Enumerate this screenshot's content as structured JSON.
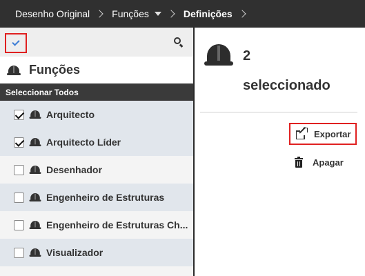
{
  "breadcrumb": {
    "items": [
      "Desenho Original",
      "Funções",
      "Definições"
    ]
  },
  "toolbar": {
    "select_toggle_icon": "checkmark-icon",
    "search_icon": "search-icon"
  },
  "panel": {
    "title": "Funções",
    "select_all_label": "Seleccionar Todos",
    "items": [
      {
        "label": "Arquitecto",
        "checked": true
      },
      {
        "label": "Arquitecto Líder",
        "checked": true
      },
      {
        "label": "Desenhador",
        "checked": false
      },
      {
        "label": "Engenheiro de Estruturas",
        "checked": false
      },
      {
        "label": "Engenheiro de Estruturas Ch...",
        "checked": false
      },
      {
        "label": "Visualizador",
        "checked": false
      }
    ]
  },
  "selection": {
    "count": "2",
    "label": "seleccionado"
  },
  "actions": {
    "export_label": "Exportar",
    "delete_label": "Apagar"
  },
  "colors": {
    "topbar": "#303030",
    "highlight_border": "#e02020",
    "check_accent": "#3a7bd5",
    "row_shaded": "#e1e6ec"
  }
}
